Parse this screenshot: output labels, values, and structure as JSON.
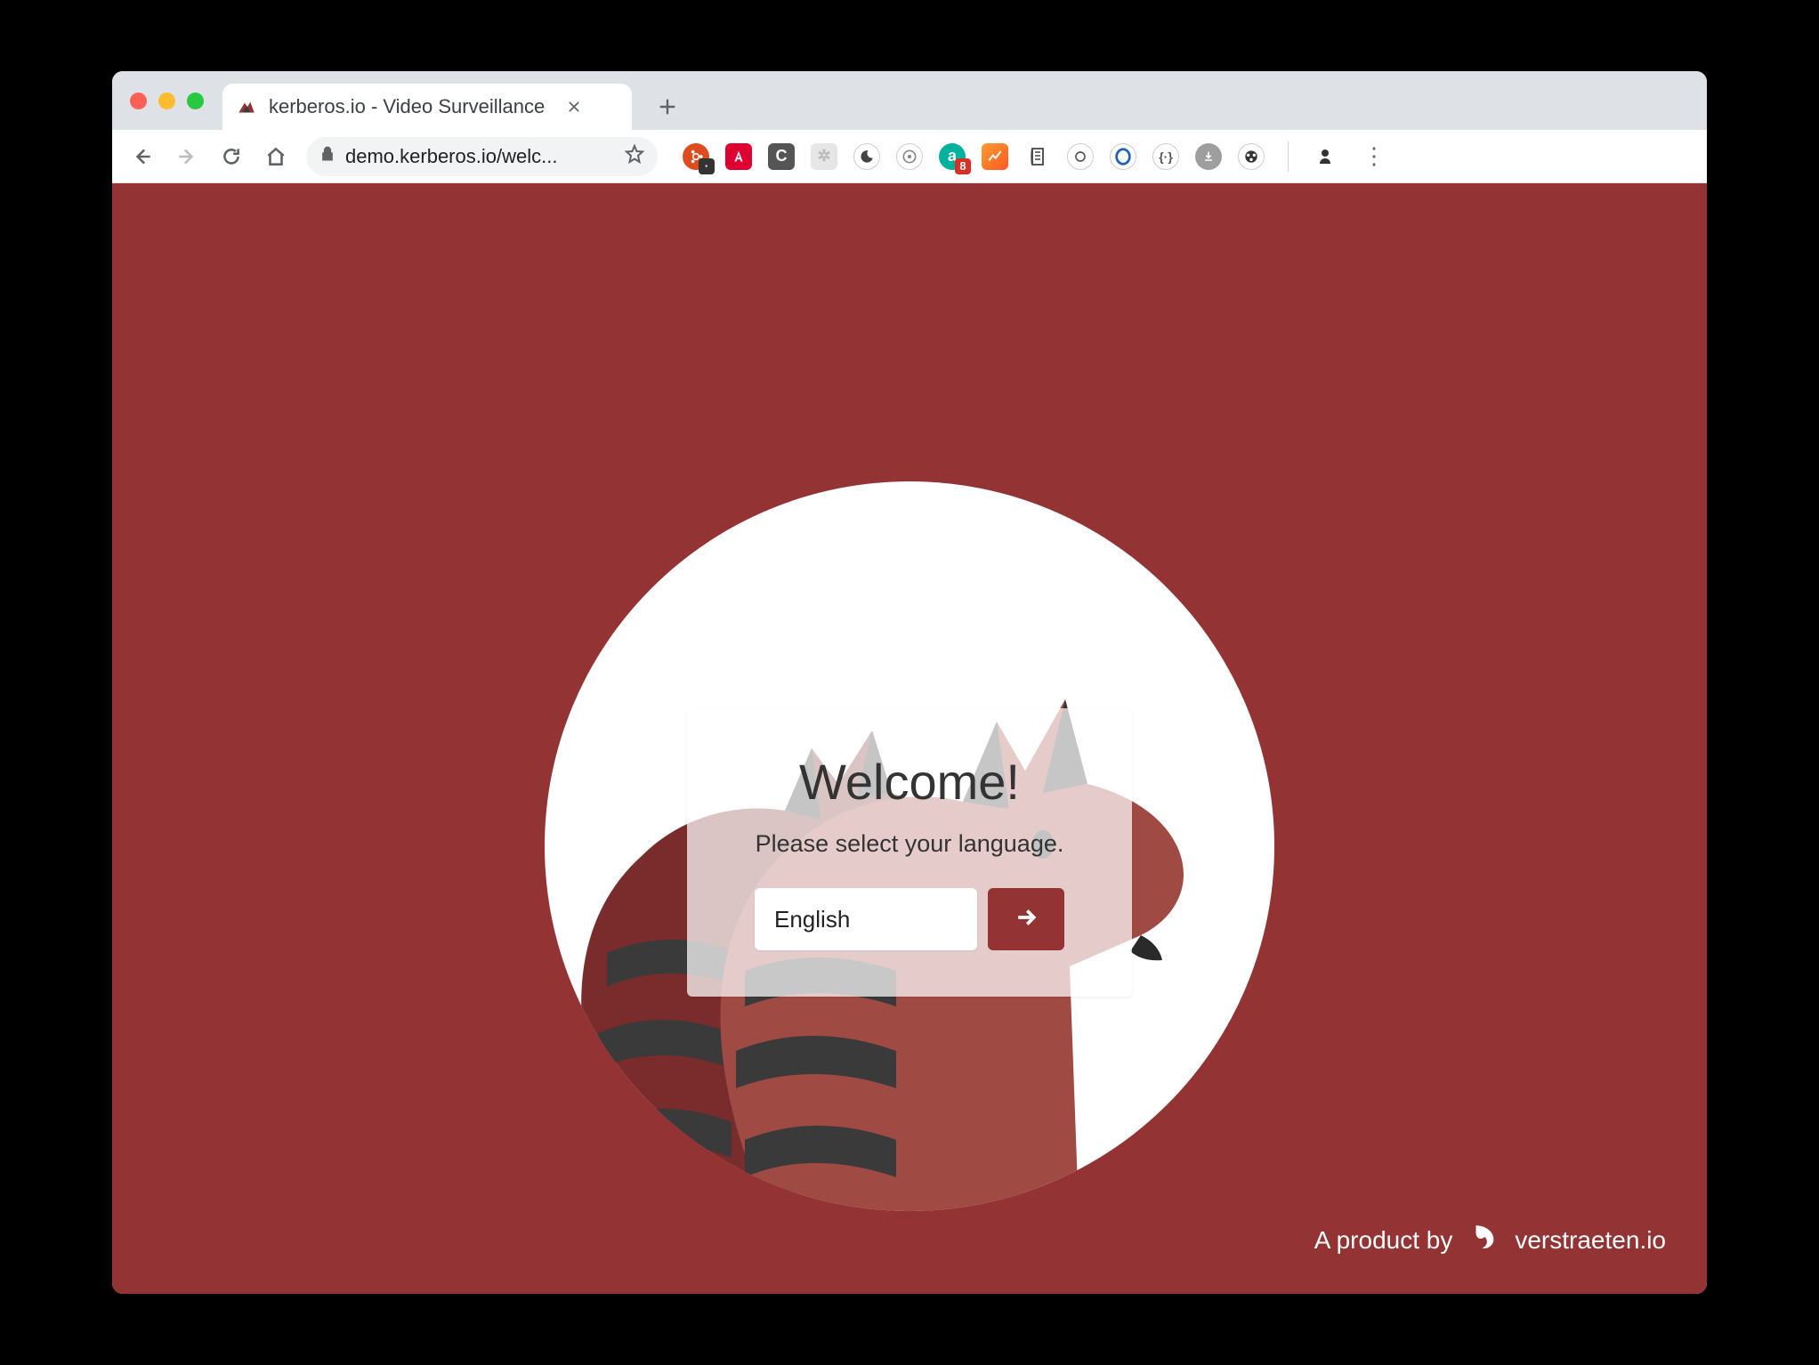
{
  "browser": {
    "tab": {
      "title": "kerberos.io - Video Surveillance"
    },
    "omnibox": {
      "url_display": "demo.kerberos.io/welc..."
    },
    "extensions": {
      "avast_badge": "8"
    }
  },
  "page": {
    "welcome_title": "Welcome!",
    "welcome_subtitle": "Please select your language.",
    "language_selected": "English",
    "footer_prefix": "A product by",
    "footer_brand": "verstraeten.io"
  }
}
